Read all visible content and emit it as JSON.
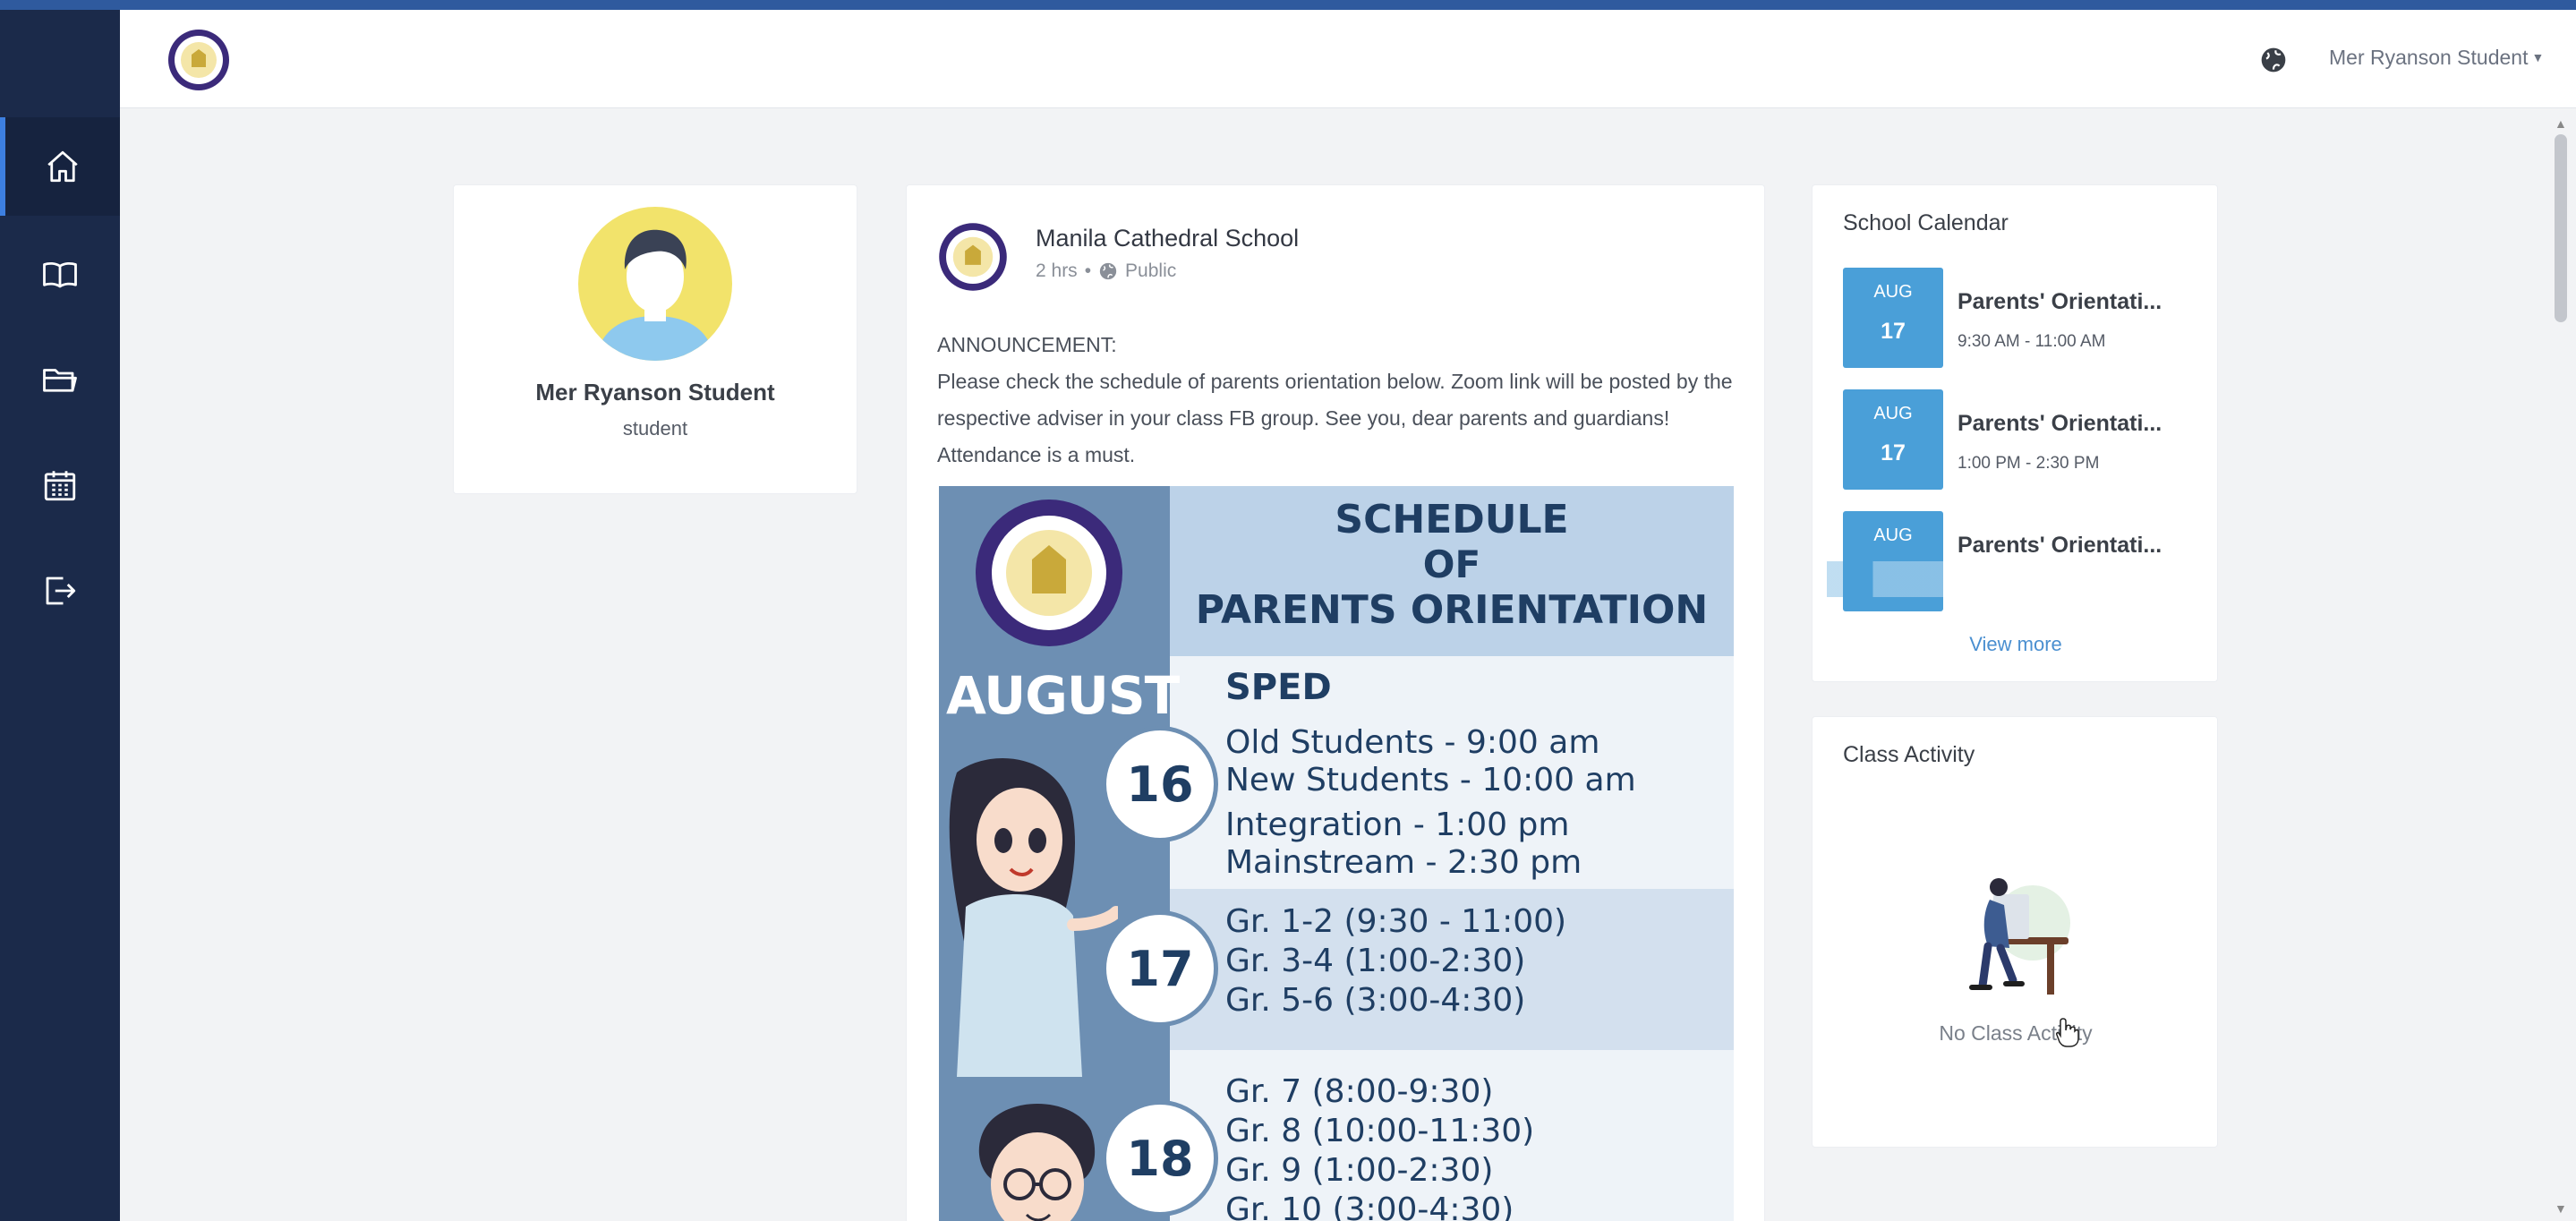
{
  "topbar": {
    "user_name": "Mer Ryanson Student"
  },
  "sidebar": {
    "items": [
      {
        "icon": "home-icon"
      },
      {
        "icon": "book-icon"
      },
      {
        "icon": "folder-icon"
      },
      {
        "icon": "calendar-icon"
      },
      {
        "icon": "logout-icon"
      }
    ]
  },
  "profile": {
    "name": "Mer Ryanson Student",
    "role": "student"
  },
  "post": {
    "author": "Manila Cathedral School",
    "time": "2 hrs",
    "separator": "•",
    "visibility": "Public",
    "text_heading": "ANNOUNCEMENT:",
    "text_body": "Please check the schedule of parents orientation below. Zoom link will be posted by the respective adviser in your class FB group. See you, dear parents and guardians! Attendance is a must.",
    "poster": {
      "title_line1": "SCHEDULE",
      "title_line2": "OF",
      "title_line3": "PARENTS ORIENTATION",
      "month": "AUGUST",
      "section": "SPED",
      "days": [
        {
          "day": "16",
          "lines": [
            "Old Students - 9:00 am",
            "New Students - 10:00 am",
            "Integration - 1:00 pm",
            "Mainstream - 2:30 pm"
          ]
        },
        {
          "day": "17",
          "lines": [
            "Gr. 1-2 (9:30 - 11:00)",
            "Gr. 3-4 (1:00-2:30)",
            "Gr. 5-6 (3:00-4:30)"
          ]
        },
        {
          "day": "18",
          "lines": [
            "Gr. 7 (8:00-9:30)",
            "Gr. 8 (10:00-11:30)",
            "Gr. 9 (1:00-2:30)",
            "Gr. 10 (3:00-4:30)"
          ]
        }
      ]
    }
  },
  "calendar": {
    "title": "School Calendar",
    "events": [
      {
        "month": "AUG",
        "day": "17",
        "title": "Parents' Orientati...",
        "time": "9:30 AM - 11:00 AM"
      },
      {
        "month": "AUG",
        "day": "17",
        "title": "Parents' Orientati...",
        "time": "1:00 PM - 2:30 PM"
      },
      {
        "month": "AUG",
        "day": "",
        "title": "Parents' Orientati...",
        "time": ""
      }
    ],
    "view_more": "View more"
  },
  "class_activity": {
    "title": "Class Activity",
    "empty_text": "No Class Activity"
  },
  "colors": {
    "sidebar": "#1b2a4a",
    "accent": "#4a9fd8",
    "top_stripe": "#2f5a9e"
  }
}
